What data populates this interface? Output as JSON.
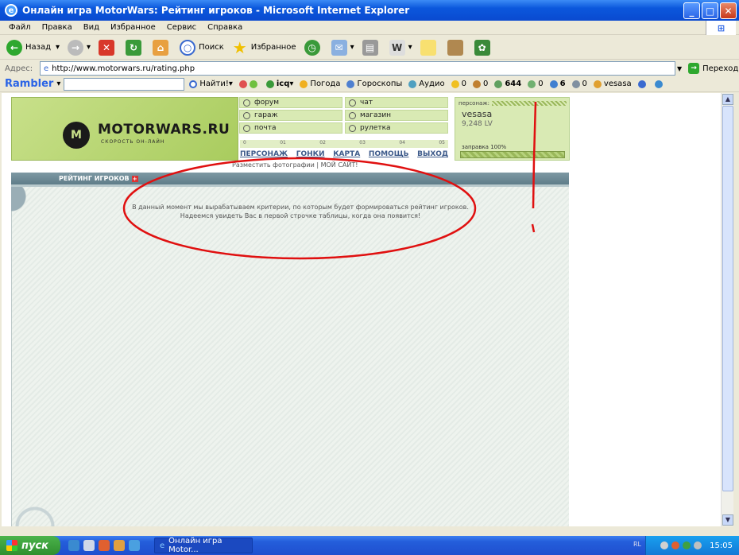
{
  "window": {
    "title": "Онлайн игра MotorWars: Рейтинг игроков - Microsoft Internet Explorer"
  },
  "menu": [
    "Файл",
    "Правка",
    "Вид",
    "Избранное",
    "Сервис",
    "Справка"
  ],
  "toolbar": {
    "back": "Назад",
    "search": "Поиск",
    "favorites": "Избранное"
  },
  "address": {
    "label": "Адрес:",
    "url": "http://www.motorwars.ru/rating.php",
    "go": "Переход"
  },
  "rambler": {
    "logo": "Rambler",
    "find": "Найти!",
    "icq": "icq",
    "weather": "Погода",
    "horoscopes": "Гороскопы",
    "audio": "Аудио",
    "counters": [
      "0",
      "0",
      "644",
      "0",
      "6",
      "0"
    ],
    "user": "vesasa"
  },
  "site": {
    "logo_name": "MOTORWARS.RU",
    "logo_mark": "M",
    "tagline": "СКОРОСТЬ ОН-ЛАЙН",
    "menu": [
      "форум",
      "чат",
      "гараж",
      "магазин",
      "почта",
      "рулетка"
    ],
    "ruler": [
      "0",
      "01",
      "02",
      "03",
      "04",
      "05"
    ],
    "nav": [
      "ПЕРСОНАЖ",
      "ГОНКИ",
      "КАРТА",
      "ПОМОЩЬ",
      "ВЫХОД"
    ],
    "photo_links": "Разместить фотографии | МОЙ САЙТ!",
    "char_header": "персонаж:",
    "char_name": "vesasa",
    "char_level": "9,248 LV",
    "fuel": "заправка 100%",
    "fuel_level": 1.0,
    "panel_title": "РЕЙТИНГ ИГРОКОВ",
    "panel_plus": "+",
    "message": "В данный момент мы вырабатываем критерии, по которым будет формироваться рейтинг игроков. Надеемся увидеть Вас в первой строчке таблицы, когда она появится!"
  },
  "taskbar": {
    "start": "пуск",
    "task": "Онлайн игра Motor...",
    "lang": "RL",
    "clock": "15:05"
  },
  "colors": {
    "annotation": "#e01010",
    "accent": "#a9cc5e",
    "panel_head": "#6a8793"
  }
}
